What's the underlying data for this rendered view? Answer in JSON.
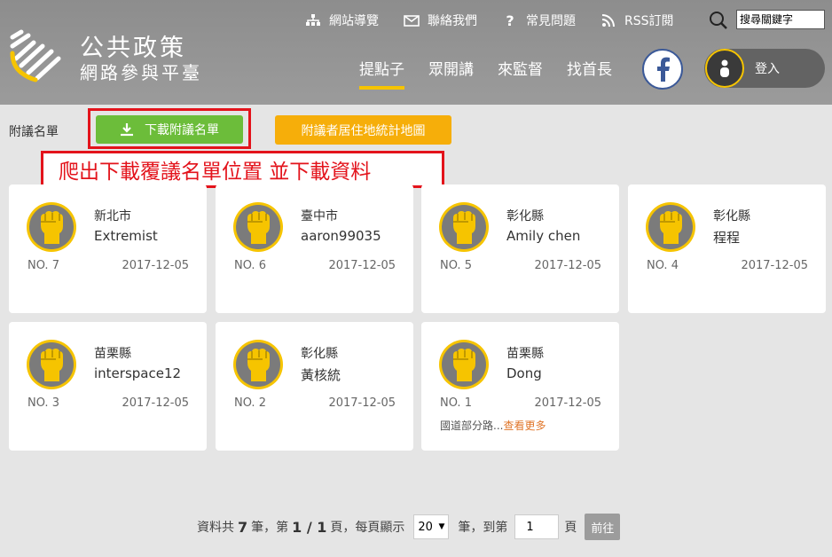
{
  "logo": {
    "line1": "公共政策",
    "line2": "網路參與平臺"
  },
  "toplinks": [
    {
      "label": "網站導覽",
      "icon": "sitemap-icon"
    },
    {
      "label": "聯絡我們",
      "icon": "mail-icon"
    },
    {
      "label": "常見問題",
      "icon": "question-icon"
    },
    {
      "label": "RSS訂閱",
      "icon": "rss-icon"
    }
  ],
  "search": {
    "placeholder": "搜尋關鍵字"
  },
  "nav": [
    {
      "label": "提點子",
      "active": true
    },
    {
      "label": "眾開講",
      "active": false
    },
    {
      "label": "來監督",
      "active": false
    },
    {
      "label": "找首長",
      "active": false
    }
  ],
  "login": {
    "label": "登入"
  },
  "section_label": "附議名單",
  "download_button": "下載附議名單",
  "map_button": "附議者居住地統計地圖",
  "annotation": "爬出下載覆議名單位置 並下載資料",
  "cards": [
    {
      "city": "新北市",
      "name": "Extremist",
      "no": "NO. 7",
      "date": "2017-12-05"
    },
    {
      "city": "臺中市",
      "name": "aaron99035",
      "no": "NO. 6",
      "date": "2017-12-05"
    },
    {
      "city": "彰化縣",
      "name": "Amily chen",
      "no": "NO. 5",
      "date": "2017-12-05"
    },
    {
      "city": "彰化縣",
      "name": "程程",
      "no": "NO. 4",
      "date": "2017-12-05"
    },
    {
      "city": "苗栗縣",
      "name": "interspace12",
      "no": "NO. 3",
      "date": "2017-12-05"
    },
    {
      "city": "彰化縣",
      "name": "黃核統",
      "no": "NO. 2",
      "date": "2017-12-05"
    },
    {
      "city": "苗栗縣",
      "name": "Dong",
      "no": "NO. 1",
      "date": "2017-12-05",
      "desc": "國道部分路...",
      "more": "查看更多"
    }
  ],
  "pager": {
    "t1": "資料共",
    "total": "7",
    "t2": "筆，第",
    "page": "1 / 1",
    "t3": "頁，每頁顯示",
    "per_page": "20",
    "t4": "筆，到第",
    "goto_value": "1",
    "t5": "頁",
    "go": "前往"
  },
  "colors": {
    "accent": "#f6c400",
    "green": "#6cbd3a",
    "orange": "#f6ae0a",
    "annotation_red": "#e3131b"
  }
}
